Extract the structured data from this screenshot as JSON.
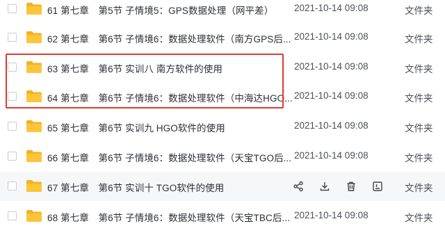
{
  "files": [
    {
      "name": "61 第七章　第5节 子情境5：GPS数据处理（网平差）",
      "time": "2021-10-14 09:08",
      "type": "文件夹"
    },
    {
      "name": "62 第七章　第6节 子情境6：数据处理软件（南方GPS后...",
      "time": "2021-10-14 09:08",
      "type": "文件夹"
    },
    {
      "name": "63 第七章　第6节 实训八 南方软件的使用",
      "time": "2021-10-14 09:08",
      "type": "文件夹"
    },
    {
      "name": "64 第七章　第6节 子情境6：数据处理软件（中海达HGO...",
      "time": "2021-10-14 09:08",
      "type": "文件夹"
    },
    {
      "name": "65 第七章　第6节 实训九 HGO软件的使用",
      "time": "2021-10-14 09:08",
      "type": "文件夹"
    },
    {
      "name": "66 第七章　第6节 子情境6：数据处理软件（天宝TGO后...",
      "time": "2021-10-14 09:08",
      "type": "文件夹"
    },
    {
      "name": "67 第七章　第6节 实训十 TGO软件的使用",
      "time": "",
      "type": "文件夹"
    },
    {
      "name": "68 第七章　第6节 子情境6：数据处理软件（天宝TBC后...",
      "time": "2021-10-14 09:08",
      "type": "文件夹"
    }
  ],
  "hover_actions": {
    "icons": [
      "share-icon",
      "download-icon",
      "delete-icon",
      "more-icon"
    ]
  },
  "colors": {
    "folder": "#fcc53a",
    "folder_tab": "#f5b21d",
    "highlight_border": "#e03a2e",
    "hover_bg": "#f6f7f9",
    "action_icon": "#40444b"
  }
}
